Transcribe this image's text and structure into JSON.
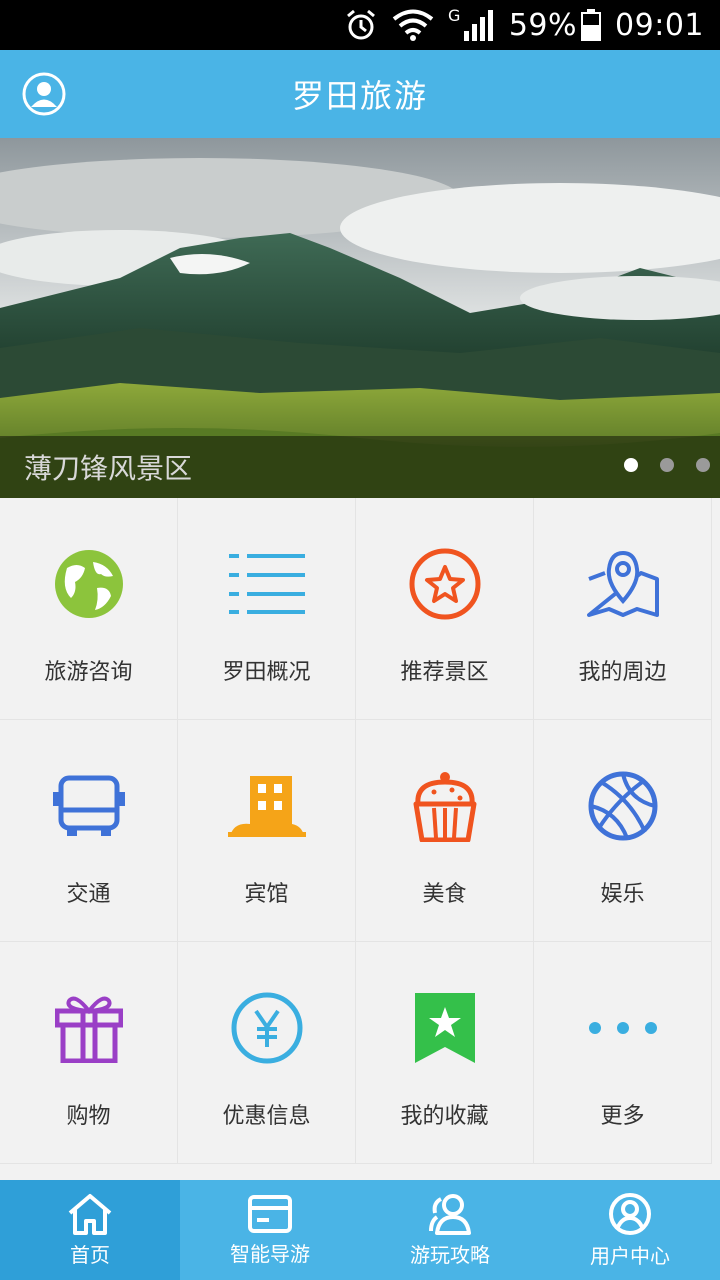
{
  "status_bar": {
    "battery": "59%",
    "time": "09:01",
    "network": "G"
  },
  "header": {
    "title": "罗田旅游",
    "avatar_icon": "user-avatar-icon"
  },
  "banner": {
    "caption": "薄刀锋风景区",
    "slides": 3,
    "active_slide": 1
  },
  "menu": [
    {
      "label": "旅游咨询",
      "icon": "globe-icon",
      "color": "#8cc43c"
    },
    {
      "label": "罗田概况",
      "icon": "list-icon",
      "color": "#3aaee0"
    },
    {
      "label": "推荐景区",
      "icon": "star-badge-icon",
      "color": "#f0541f"
    },
    {
      "label": "我的周边",
      "icon": "map-pin-icon",
      "color": "#3f72d8"
    },
    {
      "label": "交通",
      "icon": "bus-icon",
      "color": "#3f72d8"
    },
    {
      "label": "宾馆",
      "icon": "hotel-icon",
      "color": "#f5a418"
    },
    {
      "label": "美食",
      "icon": "cupcake-icon",
      "color": "#f0541f"
    },
    {
      "label": "娱乐",
      "icon": "basketball-icon",
      "color": "#3f72d8"
    },
    {
      "label": "购物",
      "icon": "gift-icon",
      "color": "#9a3fc6"
    },
    {
      "label": "优惠信息",
      "icon": "yen-coin-icon",
      "color": "#3aaee0"
    },
    {
      "label": "我的收藏",
      "icon": "bookmark-star-icon",
      "color": "#34c04a"
    },
    {
      "label": "更多",
      "icon": "more-dots-icon",
      "color": "#3aaee0"
    }
  ],
  "tabbar": [
    {
      "label": "首页",
      "icon": "home-icon",
      "active": true
    },
    {
      "label": "智能导游",
      "icon": "card-icon",
      "active": false
    },
    {
      "label": "游玩攻略",
      "icon": "users-icon",
      "active": false
    },
    {
      "label": "用户中心",
      "icon": "user-circle-icon",
      "active": false
    }
  ],
  "colors": {
    "primary": "#4ab4e6",
    "primary_dark": "#2f9fd8",
    "background": "#f2f2f2"
  }
}
